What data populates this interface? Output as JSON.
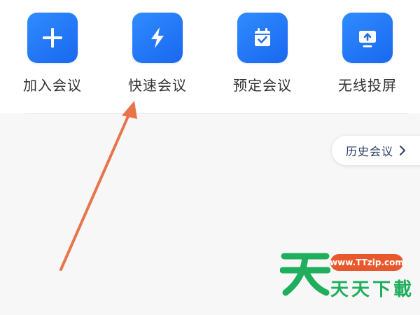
{
  "actions": [
    {
      "label": "加入会议",
      "icon": "plus-icon"
    },
    {
      "label": "快速会议",
      "icon": "lightning-icon"
    },
    {
      "label": "预定会议",
      "icon": "calendar-check-icon"
    },
    {
      "label": "无线投屏",
      "icon": "screen-share-icon"
    }
  ],
  "history": {
    "label": "历史会议",
    "icon": "chevron-right-icon"
  },
  "watermark": {
    "url": "www.TTzip.com",
    "name": "天天下載"
  },
  "colors": {
    "tile": "#1f74f5",
    "annotation_arrow": "#e8744a",
    "watermark_green": "#1fae5c",
    "watermark_orange": "#e9572c"
  }
}
